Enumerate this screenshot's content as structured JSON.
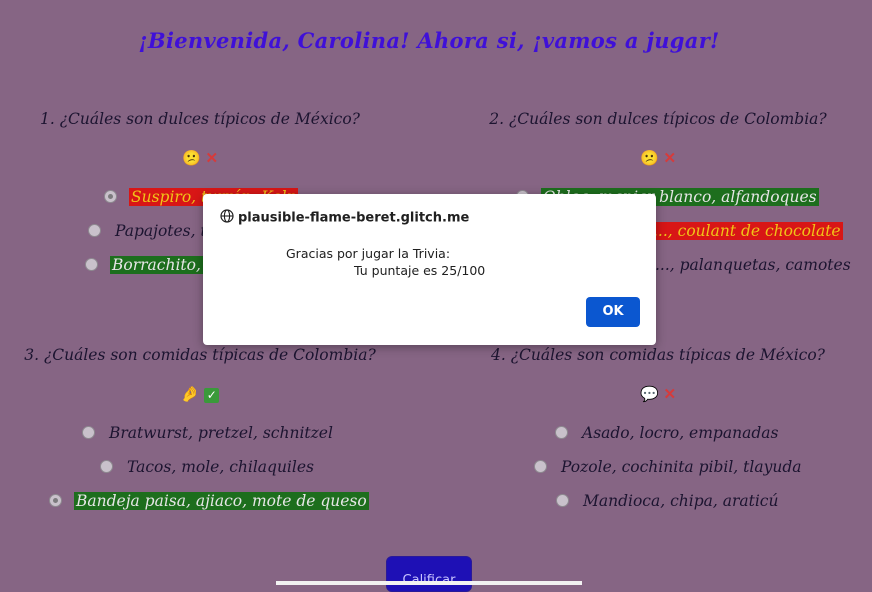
{
  "header": {
    "title": "¡Bienvenida, Carolina! Ahora si, ¡vamos a jugar!"
  },
  "questions": [
    {
      "text": "1. ¿Cuáles son dulces típicos de México?",
      "icons": [
        "thinking-face-icon",
        "cross-mark-icon"
      ],
      "options": [
        {
          "label": "Suspiro, turrón, Kelp",
          "state": "wrong",
          "checked": true
        },
        {
          "label": "Papajotes, tarta, ...",
          "state": "none",
          "checked": false
        },
        {
          "label": "Borrachito, ...",
          "state": "right",
          "checked": false
        }
      ]
    },
    {
      "text": "2. ¿Cuáles son dulces típicos de Colombia?",
      "icons": [
        "thinking-face-icon",
        "cross-mark-icon"
      ],
      "options": [
        {
          "label": "Oblea, manjar blanco, alfandoques",
          "state": "right",
          "checked": false
        },
        {
          "label": "..., coulant de chocolate",
          "state": "wrong",
          "checked": true
        },
        {
          "label": "..., palanquetas, camotes",
          "state": "none",
          "checked": false
        }
      ]
    },
    {
      "text": "3. ¿Cuáles son comidas típicas de Colombia?",
      "icons": [
        "hand-icon",
        "check-mark-icon"
      ],
      "options": [
        {
          "label": "Bratwurst, pretzel, schnitzel",
          "state": "none",
          "checked": false
        },
        {
          "label": "Tacos, mole, chilaquiles",
          "state": "none",
          "checked": false
        },
        {
          "label": "Bandeja paisa, ajiaco, mote de queso",
          "state": "right",
          "checked": true
        }
      ]
    },
    {
      "text": "4. ¿Cuáles son comidas típicas de México?",
      "icons": [
        "speech-bubble-icon",
        "cross-mark-icon"
      ],
      "options": [
        {
          "label": "Asado, locro, empanadas",
          "state": "none",
          "checked": false
        },
        {
          "label": "Pozole, cochinita pibil, tlayuda",
          "state": "none",
          "checked": false
        },
        {
          "label": "Mandioca, chipa, araticú",
          "state": "none",
          "checked": false
        }
      ]
    }
  ],
  "submit": {
    "label": "Calificar"
  },
  "dialog": {
    "origin": "plausible-flame-beret.glitch.me",
    "line1": "Gracias por jugar la Trivia:",
    "line2": "Tu puntaje es 25/100",
    "ok_label": "OK"
  },
  "colors": {
    "background": "#866584",
    "title": "#3f10d8",
    "wrong_bg": "#d81616",
    "wrong_text": "#f0c318",
    "right_bg": "#1d6e1d",
    "button": "#1e10b5",
    "dialog_ok": "#0b57d0"
  }
}
